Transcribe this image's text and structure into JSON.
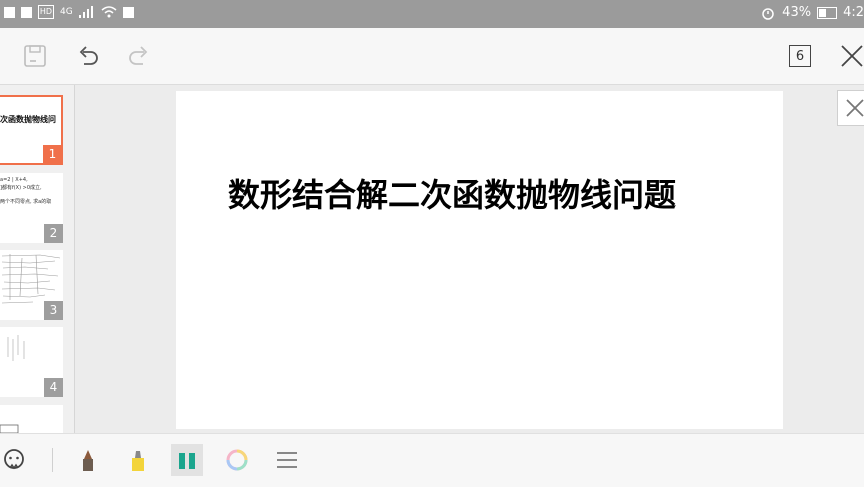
{
  "status_bar": {
    "hd_badge": "HD",
    "signal_label": "4G",
    "battery_percent": "43%",
    "time": "4:2"
  },
  "toolbar": {
    "page_count": "6"
  },
  "thumbnails": [
    {
      "number": "1",
      "title": "次函数抛物线问",
      "selected": true
    },
    {
      "number": "2",
      "lines": [
        "a=2 | X+4,",
        "]都有f(X) >0成立,",
        "两个不同零点, 求a的取"
      ]
    },
    {
      "number": "3"
    },
    {
      "number": "4"
    },
    {
      "number": ""
    }
  ],
  "slide": {
    "title": "数形结合解二次函数抛物线问题"
  },
  "bottom_toolbar": {
    "items": [
      "chat-icon",
      "pen-icon",
      "highlighter-icon",
      "eraser-icon",
      "color-picker-icon",
      "menu-icon"
    ],
    "active_item": "eraser-icon",
    "pen_color": "#6d5d50",
    "highlighter_color": "#f3d43a",
    "eraser_color": "#1aa58d"
  }
}
